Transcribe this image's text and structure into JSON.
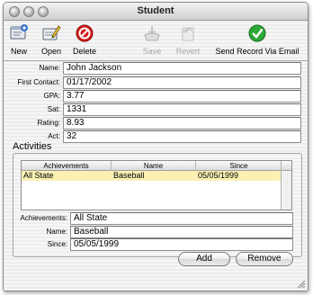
{
  "window": {
    "title": "Student"
  },
  "toolbar": {
    "items": [
      {
        "label": "New",
        "icon": "new-icon",
        "enabled": true
      },
      {
        "label": "Open",
        "icon": "open-icon",
        "enabled": true
      },
      {
        "label": "Delete",
        "icon": "delete-icon",
        "enabled": true
      },
      {
        "label": "Save",
        "icon": "save-icon",
        "enabled": false
      },
      {
        "label": "Revert",
        "icon": "revert-icon",
        "enabled": false
      },
      {
        "label": "Send Record Via Email",
        "icon": "send-email-icon",
        "enabled": true
      }
    ]
  },
  "form": {
    "fields": [
      {
        "label": "Name:",
        "value": "John Jackson"
      },
      {
        "label": "First Contact:",
        "value": "01/17/2002"
      },
      {
        "label": "GPA:",
        "value": "3.77"
      },
      {
        "label": "Sat:",
        "value": "1331"
      },
      {
        "label": "Rating:",
        "value": "8.93"
      },
      {
        "label": "Act:",
        "value": "32"
      }
    ]
  },
  "activities": {
    "title": "Activities",
    "columns": [
      "Achievements",
      "Name",
      "Since"
    ],
    "rows": [
      [
        "All State",
        "Baseball",
        "05/05/1999"
      ]
    ],
    "detail": [
      {
        "label": "Achievements:",
        "value": "All State"
      },
      {
        "label": "Name:",
        "value": "Baseball"
      },
      {
        "label": "Since:",
        "value": "05/05/1999"
      }
    ],
    "add_label": "Add",
    "remove_label": "Remove"
  },
  "colors": {
    "selected_row": "#fbf0b4",
    "delete_red": "#d41c1c",
    "send_green": "#2ea836"
  }
}
